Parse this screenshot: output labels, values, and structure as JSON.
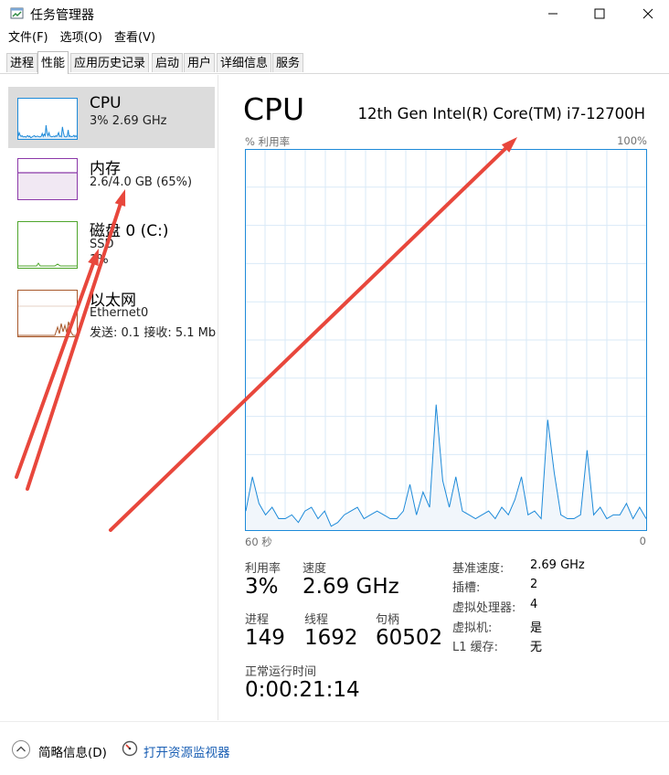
{
  "window": {
    "title": "任务管理器",
    "icon": "task-manager-icon"
  },
  "menu": [
    "文件(F)",
    "选项(O)",
    "查看(V)"
  ],
  "tabs": [
    "进程",
    "性能",
    "应用历史记录",
    "启动",
    "用户",
    "详细信息",
    "服务"
  ],
  "active_tab": "性能",
  "resources": [
    {
      "name": "CPU",
      "line1": "3%  2.69 GHz",
      "line2": "",
      "color": "#1d8ad9",
      "selected": true
    },
    {
      "name": "内存",
      "line1": "2.6/4.0 GB (65%)",
      "line2": "",
      "color": "#8b38a8",
      "selected": false
    },
    {
      "name": "磁盘 0 (C:)",
      "line1": "SSD",
      "line2": "1%",
      "color": "#4ea52b",
      "selected": false
    },
    {
      "name": "以太网",
      "line1": "Ethernet0",
      "line2": "发送: 0.1  接收: 5.1 Mb",
      "color": "#a7582a",
      "selected": false
    }
  ],
  "main": {
    "title": "CPU",
    "model": "12th Gen Intel(R) Core(TM) i7-12700H",
    "axis_top_left": "% 利用率",
    "axis_top_right": "100%",
    "axis_bottom_left": "60 秒",
    "axis_bottom_right": "0",
    "stats": {
      "utilization_label": "利用率",
      "utilization": "3%",
      "speed_label": "速度",
      "speed": "2.69 GHz",
      "processes_label": "进程",
      "processes": "149",
      "threads_label": "线程",
      "threads": "1692",
      "handles_label": "句柄",
      "handles": "60502",
      "uptime_label": "正常运行时间",
      "uptime": "0:00:21:14"
    },
    "specs": [
      {
        "label": "基准速度:",
        "value": "2.69 GHz"
      },
      {
        "label": "插槽:",
        "value": "2"
      },
      {
        "label": "虚拟处理器:",
        "value": "4"
      },
      {
        "label": "虚拟机:",
        "value": "是"
      },
      {
        "label": "L1 缓存:",
        "value": "无"
      }
    ]
  },
  "chart_data": {
    "type": "area",
    "title": "",
    "ylim": [
      0,
      100
    ],
    "xlim": [
      60,
      0
    ],
    "grid": true,
    "color": "#1d8ad9",
    "values": [
      5,
      14,
      7,
      4,
      6,
      3,
      3,
      4,
      2,
      5,
      6,
      3,
      5,
      1,
      2,
      4,
      5,
      6,
      3,
      4,
      5,
      4,
      3,
      3,
      5,
      12,
      4,
      10,
      6,
      33,
      13,
      6,
      14,
      5,
      4,
      3,
      4,
      5,
      3,
      6,
      4,
      8,
      14,
      4,
      5,
      3,
      29,
      15,
      4,
      3,
      3,
      4,
      21,
      4,
      6,
      3,
      4,
      4,
      7,
      3,
      6,
      3
    ]
  },
  "footer": {
    "brief_label": "简略信息(D)",
    "monitor_link": "打开资源监视器"
  },
  "annotation_color": "#e8473c"
}
